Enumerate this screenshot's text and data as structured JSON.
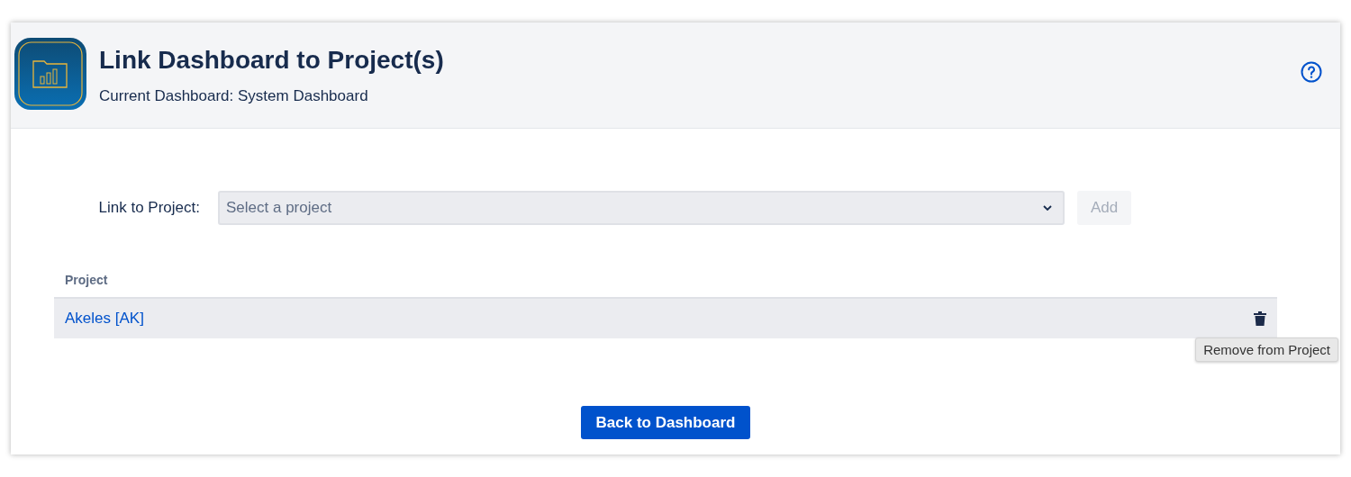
{
  "header": {
    "title": "Link Dashboard to Project(s)",
    "subtitle": "Current Dashboard: System Dashboard"
  },
  "link_form": {
    "label": "Link to Project:",
    "select": {
      "placeholder": "Select a project"
    },
    "add_button": {
      "label": "Add",
      "disabled": true
    }
  },
  "table": {
    "columns": [
      "Project"
    ],
    "rows": [
      {
        "project": "Akeles [AK]",
        "highlighted": true,
        "remove_tooltip": "Remove from Project"
      }
    ]
  },
  "back_button": "Back to Dashboard"
}
